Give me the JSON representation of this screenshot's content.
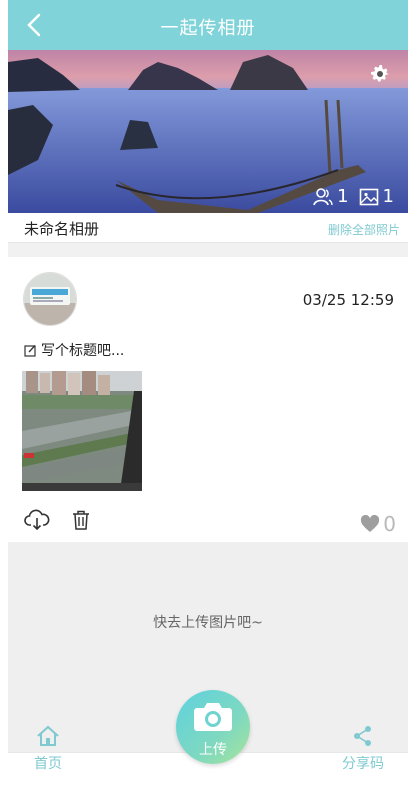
{
  "header": {
    "title": "一起传相册"
  },
  "album": {
    "name": "未命名相册",
    "delete_all_label": "删除全部照片",
    "member_count": "1",
    "photo_count": "1"
  },
  "post": {
    "timestamp": "03/25 12:59",
    "caption_placeholder": "写个标题吧...",
    "like_count": "0"
  },
  "empty_state": {
    "text": "快去上传图片吧~"
  },
  "tabbar": {
    "home_label": "首页",
    "upload_label": "上传",
    "share_label": "分享码"
  },
  "colors": {
    "accent": "#7fd3d9",
    "tab_text": "#7fc9d0",
    "empty_bg": "#efefef"
  }
}
